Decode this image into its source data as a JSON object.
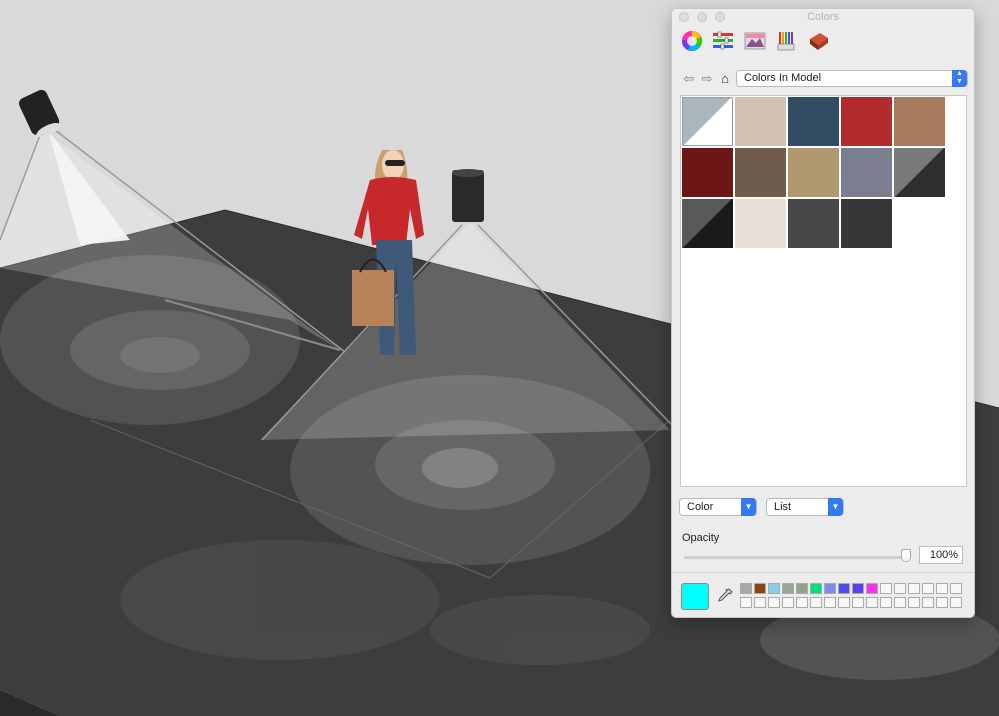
{
  "panel": {
    "title": "Colors",
    "tool_icons": [
      "color-wheel-icon",
      "color-sliders-icon",
      "image-palettes-icon",
      "pencils-icon",
      "texture-brick-icon"
    ],
    "palette_select": "Colors In Model",
    "swatches": [
      {
        "name": "default-material",
        "color": "#a9b6bd",
        "split": "#ffffff"
      },
      {
        "name": "beige",
        "color": "#d3c2b3"
      },
      {
        "name": "slate-blue",
        "color": "#314c63"
      },
      {
        "name": "red",
        "color": "#b22c2e"
      },
      {
        "name": "tan-brown",
        "color": "#a77a5e"
      },
      {
        "name": "dark-red",
        "color": "#6b1718"
      },
      {
        "name": "brown",
        "color": "#6f5c4c"
      },
      {
        "name": "khaki",
        "color": "#b2986f"
      },
      {
        "name": "gray-blue",
        "color": "#7b7e8e"
      },
      {
        "name": "gradient-texture",
        "color": "#7a7a7a",
        "split": "#2f2f2f"
      },
      {
        "name": "spotlight-texture",
        "color": "#5a5a5a",
        "split": "#1a1a1a"
      },
      {
        "name": "marble-tile-texture",
        "color": "#e9dfd6"
      },
      {
        "name": "concrete-texture",
        "color": "#474747"
      },
      {
        "name": "charcoal",
        "color": "#373737"
      }
    ],
    "mode_dropdown": "Color",
    "view_dropdown": "List",
    "opacity_label": "Opacity",
    "opacity_value": "100%",
    "opacity_level": 1.0,
    "current_color": "#00ffff",
    "favorites": [
      "#a8a8a8",
      "#8b4513",
      "#87ceeb",
      "#9aa593",
      "#8fa48a",
      "#00e07a",
      "#7b8cf0",
      "#4b4ef0",
      "#5b3ff0",
      "#ff2ff0"
    ]
  },
  "colors": {
    "accent": "#3478f6",
    "floor": "#3d3d3d",
    "background": "#d9d9d9"
  }
}
